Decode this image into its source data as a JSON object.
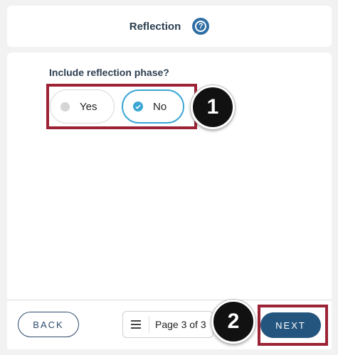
{
  "header": {
    "title": "Reflection",
    "help_icon": "help-circle-icon"
  },
  "question": {
    "label": "Include reflection phase?",
    "options": [
      {
        "label": "Yes",
        "selected": false
      },
      {
        "label": "No",
        "selected": true
      }
    ]
  },
  "annotations": {
    "badge_1": "1",
    "badge_2": "2",
    "highlight_color": "#9b2335"
  },
  "footer": {
    "back_label": "BACK",
    "page_label": "Page 3 of 3",
    "next_label": "NEXT"
  },
  "colors": {
    "accent": "#3aa6d4",
    "primary": "#24557e",
    "text": "#2c3e50"
  }
}
